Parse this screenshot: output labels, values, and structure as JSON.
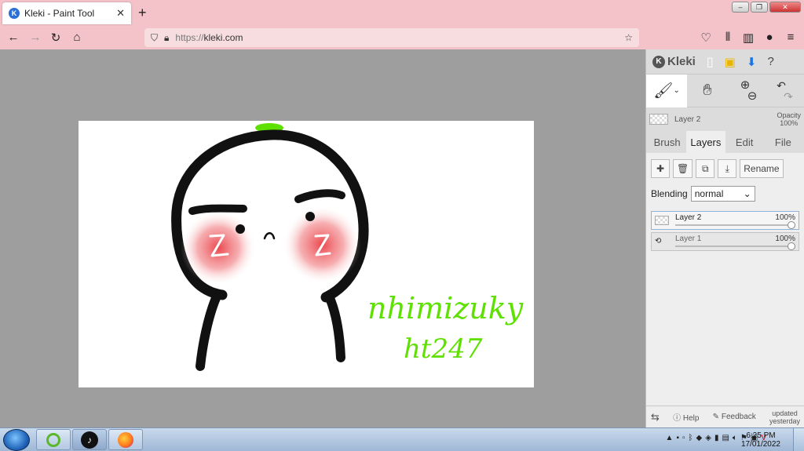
{
  "browser": {
    "tab_title": "Kleki - Paint Tool",
    "tab_close": "✕",
    "new_tab": "+",
    "url_prefix": "https://",
    "url_host": "kleki.com"
  },
  "kleki": {
    "logo": "Kleki",
    "layer_name": "Layer 2",
    "opacity_label": "Opacity",
    "opacity_value": "100%",
    "tabs": [
      {
        "label": "Brush"
      },
      {
        "label": "Layers"
      },
      {
        "label": "Edit"
      },
      {
        "label": "File"
      }
    ],
    "rename_label": "Rename",
    "blending_label": "Blending",
    "blending_value": "normal",
    "layers": [
      {
        "name": "Layer 2",
        "opacity": "100%",
        "opacity_fraction": 1.0
      },
      {
        "name": "Layer 1",
        "opacity": "100%",
        "opacity_fraction": 1.0
      }
    ],
    "footer": {
      "help": "Help",
      "feedback": "Feedback",
      "updated": "updated",
      "yesterday": "yesterday"
    }
  },
  "drawing": {
    "signature_line1": "nhimizuky",
    "signature_line2": "ht247"
  },
  "taskbar": {
    "time": "6:25 PM",
    "date": "17/01/2022"
  },
  "colors": {
    "browser_chrome": "#f3c3c9",
    "canvas_bg": "#9e9e9e",
    "accent_green": "#5ee000",
    "blush": "#e8333a"
  }
}
